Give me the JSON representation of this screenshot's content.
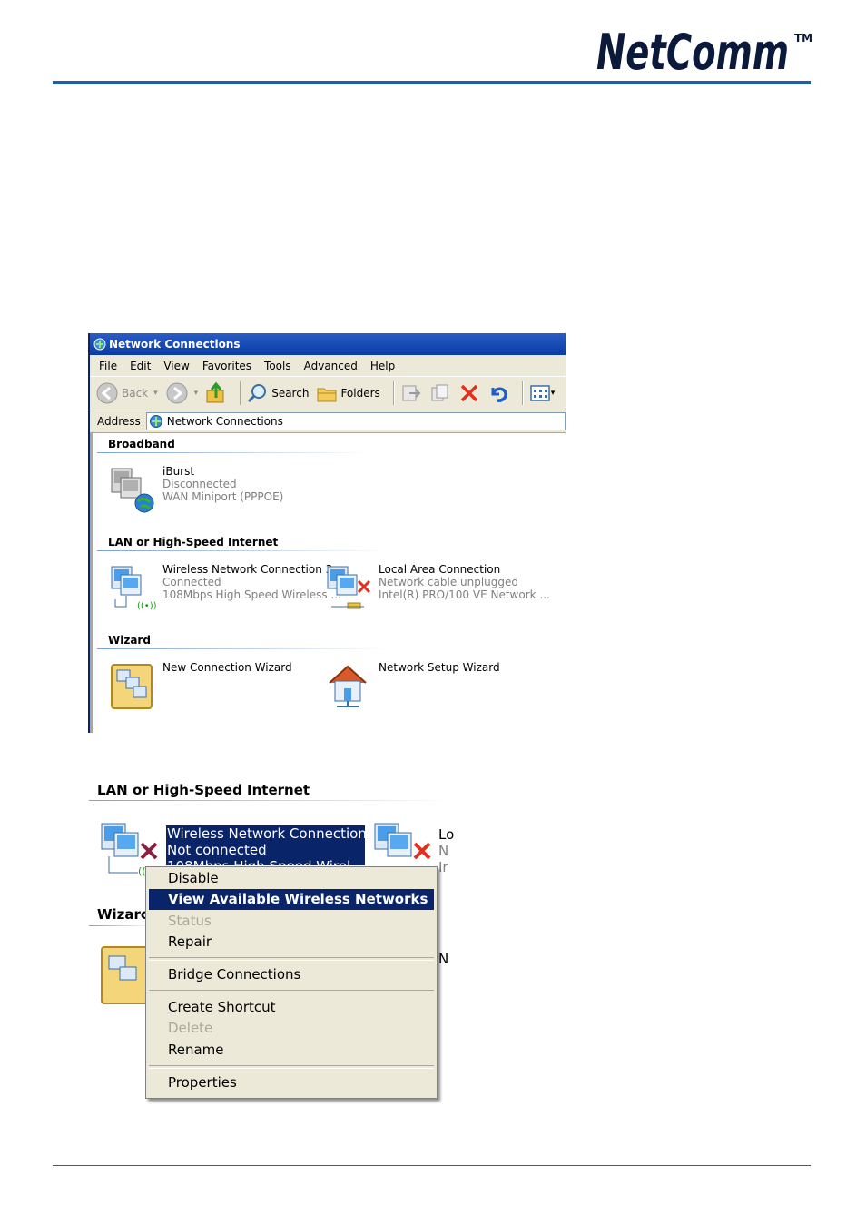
{
  "brand": {
    "logo_text": "NetComm",
    "tm": "TM",
    "accent": "#1e5fa8"
  },
  "window": {
    "title": "Network Connections",
    "menu": [
      "File",
      "Edit",
      "View",
      "Favorites",
      "Tools",
      "Advanced",
      "Help"
    ],
    "toolbar": {
      "back": "Back",
      "search": "Search",
      "folders": "Folders"
    },
    "address_label": "Address",
    "address_value": "Network Connections",
    "groups": {
      "broadband": "Broadband",
      "lan": "LAN or High-Speed Internet",
      "wizard": "Wizard"
    },
    "items": {
      "iburst": {
        "name": "iBurst",
        "status": "Disconnected",
        "device": "WAN Miniport (PPPOE)"
      },
      "wireless": {
        "name": "Wireless Network Connection 3",
        "status": "Connected",
        "device": "108Mbps High Speed Wireless ..."
      },
      "lan": {
        "name": "Local Area Connection",
        "status": "Network cable unplugged",
        "device": "Intel(R) PRO/100 VE Network ..."
      },
      "new_wizard": {
        "name": "New Connection Wizard"
      },
      "setup_wizard": {
        "name": "Network Setup Wizard"
      }
    }
  },
  "zoom": {
    "group": "LAN or High-Speed Internet",
    "selected_name": "Wireless Network Connection 3",
    "selected_status": "Not connected",
    "selected_device": "108Mbps High Speed Wirel",
    "cut_lan_1": "Lo",
    "cut_lan_2": "N",
    "cut_lan_3": "Ir",
    "cut_wizard": "Wizarc",
    "cut_n": "N"
  },
  "context_menu": {
    "items": [
      {
        "label": "Disable",
        "state": "normal"
      },
      {
        "label": "View Available Wireless Networks",
        "state": "highlighted"
      },
      {
        "label": "Status",
        "state": "disabled"
      },
      {
        "label": "Repair",
        "state": "normal"
      },
      {
        "label": "Bridge Connections",
        "state": "normal"
      },
      {
        "label": "Create Shortcut",
        "state": "normal"
      },
      {
        "label": "Delete",
        "state": "disabled"
      },
      {
        "label": "Rename",
        "state": "normal"
      },
      {
        "label": "Properties",
        "state": "normal"
      }
    ]
  }
}
